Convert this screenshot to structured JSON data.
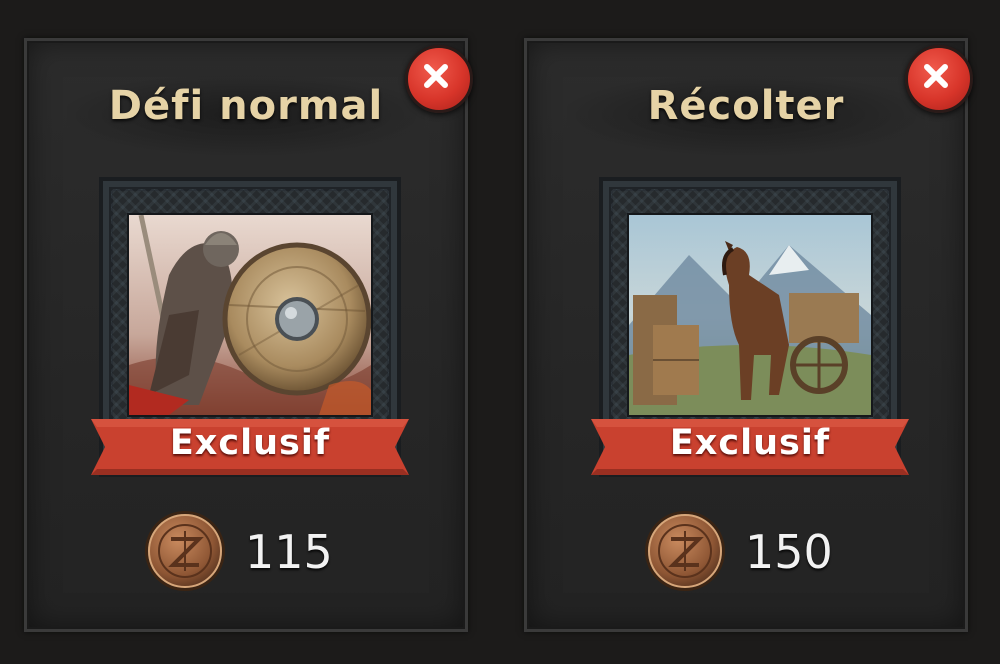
{
  "cards": [
    {
      "title": "Défi normal",
      "badge": "Exclusif",
      "cost": "115",
      "image": "warrior-with-round-shield",
      "currency_icon": "bronze-emblem-coin-icon"
    },
    {
      "title": "Récolter",
      "badge": "Exclusif",
      "cost": "150",
      "image": "horse-with-cart",
      "currency_icon": "bronze-emblem-coin-icon"
    }
  ],
  "colors": {
    "title": "#e6d3a6",
    "ribbon": "#c9412f",
    "close": "#d8352a",
    "panel": "#2a2a2a"
  }
}
